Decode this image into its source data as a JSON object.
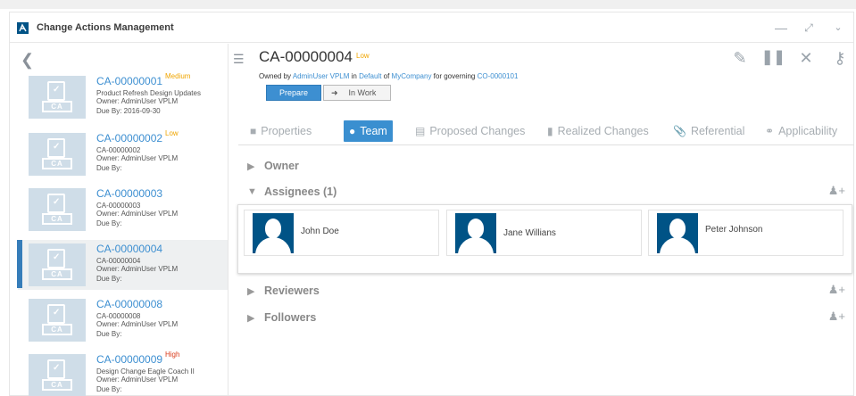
{
  "window": {
    "title": "Change Actions Management",
    "controls": [
      "minimize-icon",
      "expand-icon",
      "chevron-down-icon"
    ]
  },
  "list": {
    "items": [
      {
        "id": "CA-00000001",
        "badge": "Medium",
        "badge_color": "#f0a500",
        "desc": "Product Refresh Design Updates",
        "owner": "Owner: AdminUser VPLM",
        "due": "Due By: 2016-09-30",
        "selected": false
      },
      {
        "id": "CA-00000002",
        "badge": "Low",
        "badge_color": "#f0a500",
        "desc": "CA-00000002",
        "owner": "Owner: AdminUser VPLM",
        "due": "Due By:",
        "selected": false
      },
      {
        "id": "CA-00000003",
        "badge": "",
        "badge_color": "#f0a500",
        "desc": "CA-00000003",
        "owner": "Owner: AdminUser VPLM",
        "due": "Due By:",
        "selected": false
      },
      {
        "id": "CA-00000004",
        "badge": "",
        "badge_color": "#f0a500",
        "desc": "CA-00000004",
        "owner": "Owner: AdminUser VPLM",
        "due": "Due By:",
        "selected": true
      },
      {
        "id": "CA-00000008",
        "badge": "",
        "badge_color": "#f0a500",
        "desc": "CA-00000008",
        "owner": "Owner: AdminUser VPLM",
        "due": "Due By:",
        "selected": false
      },
      {
        "id": "CA-00000009",
        "badge": "High",
        "badge_color": "#d93a1a",
        "desc": "Design Change Eagle Coach II",
        "owner": "Owner: AdminUser VPLM",
        "due": "Due By:",
        "selected": false
      }
    ],
    "thumb_label": "CA"
  },
  "detail": {
    "title": "CA-00000004",
    "priority": "Low",
    "owned": {
      "p1": "Owned by ",
      "user": "AdminUser VPLM",
      "p2": " in ",
      "space": "Default",
      "p3": " of ",
      "org": "MyCompany",
      "p4": " for governing ",
      "co": "CO-0000101"
    },
    "state_current": "Prepare",
    "state_next": "In Work",
    "toolbar": [
      "pencil-icon",
      "pause-icon",
      "close-icon",
      "key-icon"
    ],
    "tabs": [
      {
        "label": "Properties",
        "icon": "clipboard-icon",
        "active": false
      },
      {
        "label": "Team",
        "icon": "team-icon",
        "active": true
      },
      {
        "label": "Proposed Changes",
        "icon": "list-icon",
        "active": false
      },
      {
        "label": "Realized Changes",
        "icon": "bar-chart-icon",
        "active": false
      },
      {
        "label": "Referential",
        "icon": "paperclip-icon",
        "active": false
      },
      {
        "label": "Applicability",
        "icon": "link-icon",
        "active": false
      }
    ],
    "sections": {
      "owner": "Owner",
      "assignees": "Assignees (1)",
      "reviewers": "Reviewers",
      "followers": "Followers"
    },
    "assignee_cards": [
      {
        "name": "John Doe"
      },
      {
        "name": "Jane Willians"
      },
      {
        "name": "Peter Johnson"
      }
    ]
  },
  "colors": {
    "accent": "#3a8fd0",
    "brand": "#005386",
    "badge_low": "#f0a500",
    "badge_high": "#d93a1a"
  }
}
